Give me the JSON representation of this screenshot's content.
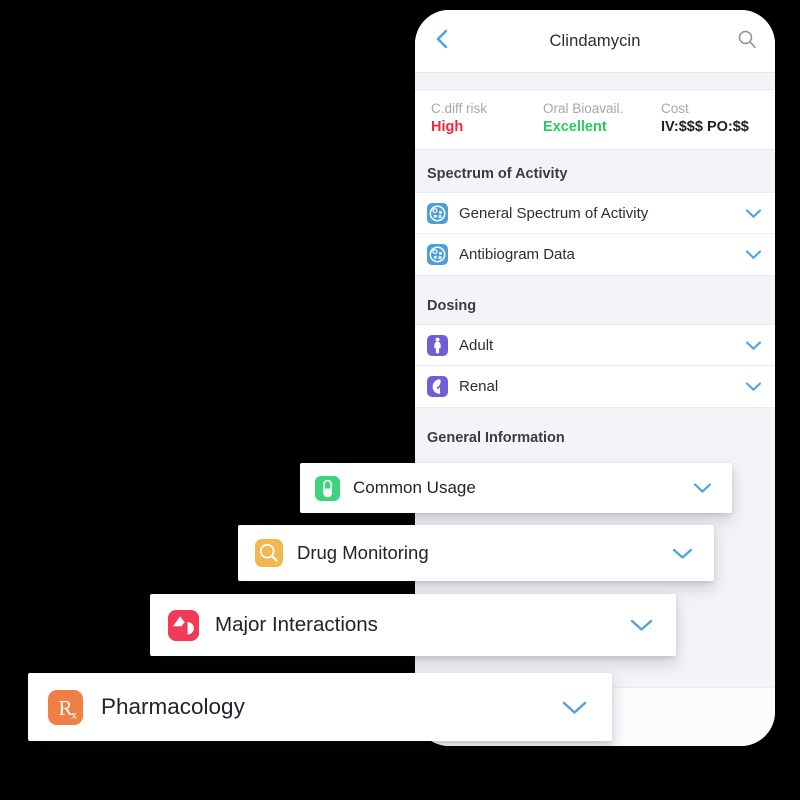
{
  "colors": {
    "accent_blue": "#4ea3e0",
    "chevron_blue": "#4ea3e0",
    "risk_high": "#f5253e",
    "bioavail_excellent": "#28cc5e",
    "icon_blue": "#4a9fd6",
    "icon_purple": "#6e5fd6",
    "icon_green": "#3ed47f",
    "icon_orange_amber": "#f2b74e",
    "icon_red": "#f03a58",
    "icon_orange": "#ef7f44",
    "section_bg": "#f3f3f8",
    "card_bg": "#ffffff",
    "page_bg": "#000000"
  },
  "navbar": {
    "title": "Clindamycin",
    "back_icon": "chevron-left-icon",
    "search_icon": "search-icon"
  },
  "stats": [
    {
      "label": "C.diff risk",
      "value": "High",
      "value_color": "#f5253e"
    },
    {
      "label": "Oral Bioavail.",
      "value": "Excellent",
      "value_color": "#28cc5e"
    },
    {
      "label": "Cost",
      "value": "IV:$$$ PO:$$",
      "value_color": "#1f1f27"
    }
  ],
  "sections": [
    {
      "title": "Spectrum of Activity",
      "rows": [
        {
          "label": "General Spectrum of Activity",
          "icon": "petri-dish-icon",
          "icon_color": "#4a9fd6",
          "chevron": "chevron-down-icon"
        },
        {
          "label": "Antibiogram Data",
          "icon": "petri-dish-icon",
          "icon_color": "#4a9fd6",
          "chevron": "chevron-down-icon"
        }
      ]
    },
    {
      "title": "Dosing",
      "rows": [
        {
          "label": "Adult",
          "icon": "person-icon",
          "icon_color": "#6e5fd6",
          "chevron": "chevron-down-icon"
        },
        {
          "label": "Renal",
          "icon": "kidney-icon",
          "icon_color": "#6e5fd6",
          "chevron": "chevron-down-icon"
        }
      ]
    },
    {
      "title": "General Information",
      "rows": []
    }
  ],
  "floating_cards": [
    {
      "label": "Common Usage",
      "icon": "pill-capsule-icon",
      "icon_color": "#3ed47f",
      "chevron": "chevron-down-icon"
    },
    {
      "label": "Drug Monitoring",
      "icon": "magnifier-icon",
      "icon_color": "#f2b74e",
      "chevron": "chevron-down-icon"
    },
    {
      "label": "Major Interactions",
      "icon": "interaction-warning-icon",
      "icon_color": "#f03a58",
      "chevron": "chevron-down-icon"
    },
    {
      "label": "Pharmacology",
      "icon": "rx-icon",
      "icon_color": "#ef7f44",
      "chevron": "chevron-down-icon"
    }
  ]
}
